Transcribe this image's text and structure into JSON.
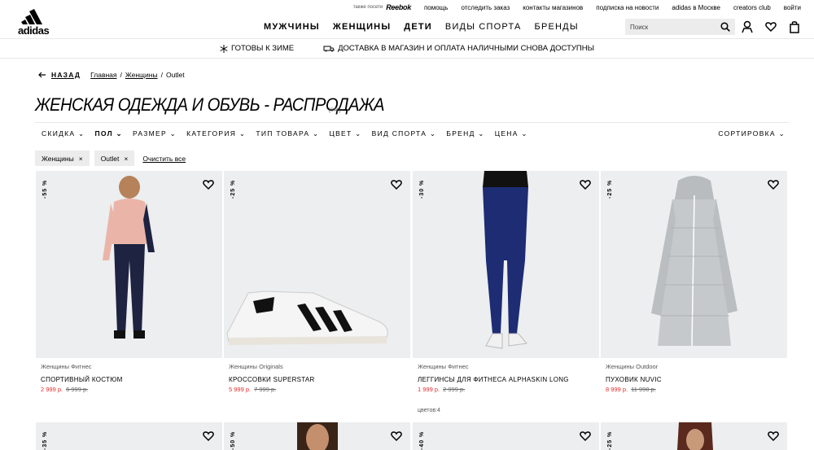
{
  "util": {
    "also": "также посети",
    "reebok": "Reebok",
    "links": [
      "помощь",
      "отследить заказ",
      "контакты магазинов",
      "подписка на новости",
      "adidas в Москве",
      "creators club",
      "войти"
    ]
  },
  "logo": "adidas",
  "nav": [
    "МУЖЧИНЫ",
    "ЖЕНЩИНЫ",
    "ДЕТИ",
    "ВИДЫ СПОРТА",
    "БРЕНДЫ"
  ],
  "search": {
    "placeholder": "Поиск"
  },
  "promo": [
    "ГОТОВЫ К ЗИМЕ",
    "ДОСТАВКА В МАГАЗИН И ОПЛАТА НАЛИЧНЫМИ СНОВА ДОСТУПНЫ"
  ],
  "breadcrumb": {
    "back": "НАЗАД",
    "items": [
      "Главная",
      "Женщины",
      "Outlet"
    ]
  },
  "page": {
    "title": "ЖЕНСКАЯ ОДЕЖДА И ОБУВЬ - РАСПРОДАЖА",
    "count": "[641]"
  },
  "filters": [
    "СКИДКА",
    "ПОЛ",
    "РАЗМЕР",
    "КАТЕГОРИЯ",
    "ТИП ТОВАРА",
    "ЦВЕТ",
    "ВИД СПОРТА",
    "БРЕНД",
    "ЦЕНА"
  ],
  "sort": "СОРТИРОВКА",
  "chips": [
    "Женщины",
    "Outlet"
  ],
  "clear_all": "Очистить все",
  "products": [
    {
      "discount": "-55 %",
      "category": "Женщины Фитнес",
      "name": "СПОРТИВНЫЙ КОСТЮМ",
      "price": "2 999 р.",
      "old_price": "6 999 р.",
      "colors": ""
    },
    {
      "discount": "-25 %",
      "category": "Женщины Originals",
      "name": "КРОССОВКИ SUPERSTAR",
      "price": "5 999 р.",
      "old_price": "7 999 р.",
      "colors": ""
    },
    {
      "discount": "-30 %",
      "category": "Женщины Фитнес",
      "name": "ЛЕГГИНСЫ ДЛЯ ФИТНЕСА ALPHASKIN LONG",
      "price": "1 999 р.",
      "old_price": "2 999 р.",
      "colors": "цветов:4"
    },
    {
      "discount": "-25 %",
      "category": "Женщины Outdoor",
      "name": "ПУХОВИК NUVIC",
      "price": "8 999 р.",
      "old_price": "11 990 р.",
      "colors": ""
    }
  ],
  "products_row2": [
    {
      "discount": "-35 %"
    },
    {
      "discount": "-50 %"
    },
    {
      "discount": "-40 %"
    },
    {
      "discount": "-25 %"
    }
  ]
}
